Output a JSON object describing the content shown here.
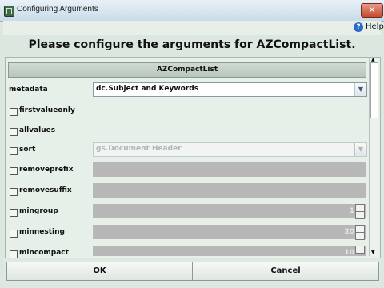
{
  "window": {
    "title": "Configuring Arguments",
    "close_glyph": "✕"
  },
  "help": {
    "label": "Help",
    "icon": "help-icon",
    "icon_glyph": "?"
  },
  "heading": "Please configure the arguments for AZCompactList.",
  "group": {
    "title": "AZCompactList"
  },
  "rows": [
    {
      "name": "metadata",
      "label": "metadata",
      "checkbox": false,
      "control": "combo",
      "value": "dc.Subject and Keywords",
      "enabled": true
    },
    {
      "name": "firstvalueonly",
      "label": "firstvalueonly",
      "checkbox": true,
      "checked": false,
      "control": "none"
    },
    {
      "name": "allvalues",
      "label": "allvalues",
      "checkbox": true,
      "checked": false,
      "control": "none"
    },
    {
      "name": "sort",
      "label": "sort",
      "checkbox": true,
      "checked": false,
      "control": "combo",
      "value": "gs.Document Header",
      "enabled": false
    },
    {
      "name": "removeprefix",
      "label": "removeprefix",
      "checkbox": true,
      "checked": false,
      "control": "text",
      "enabled": false
    },
    {
      "name": "removesuffix",
      "label": "removesuffix",
      "checkbox": true,
      "checked": false,
      "control": "text",
      "enabled": false
    },
    {
      "name": "mingroup",
      "label": "mingroup",
      "checkbox": true,
      "checked": false,
      "control": "spinner",
      "value": "1",
      "enabled": false
    },
    {
      "name": "minnesting",
      "label": "minnesting",
      "checkbox": true,
      "checked": false,
      "control": "spinner",
      "value": "20",
      "enabled": false
    },
    {
      "name": "mincompact",
      "label": "mincompact",
      "checkbox": true,
      "checked": false,
      "control": "spinner",
      "value": "10",
      "enabled": false
    }
  ],
  "buttons": {
    "ok": "OK",
    "cancel": "Cancel"
  }
}
